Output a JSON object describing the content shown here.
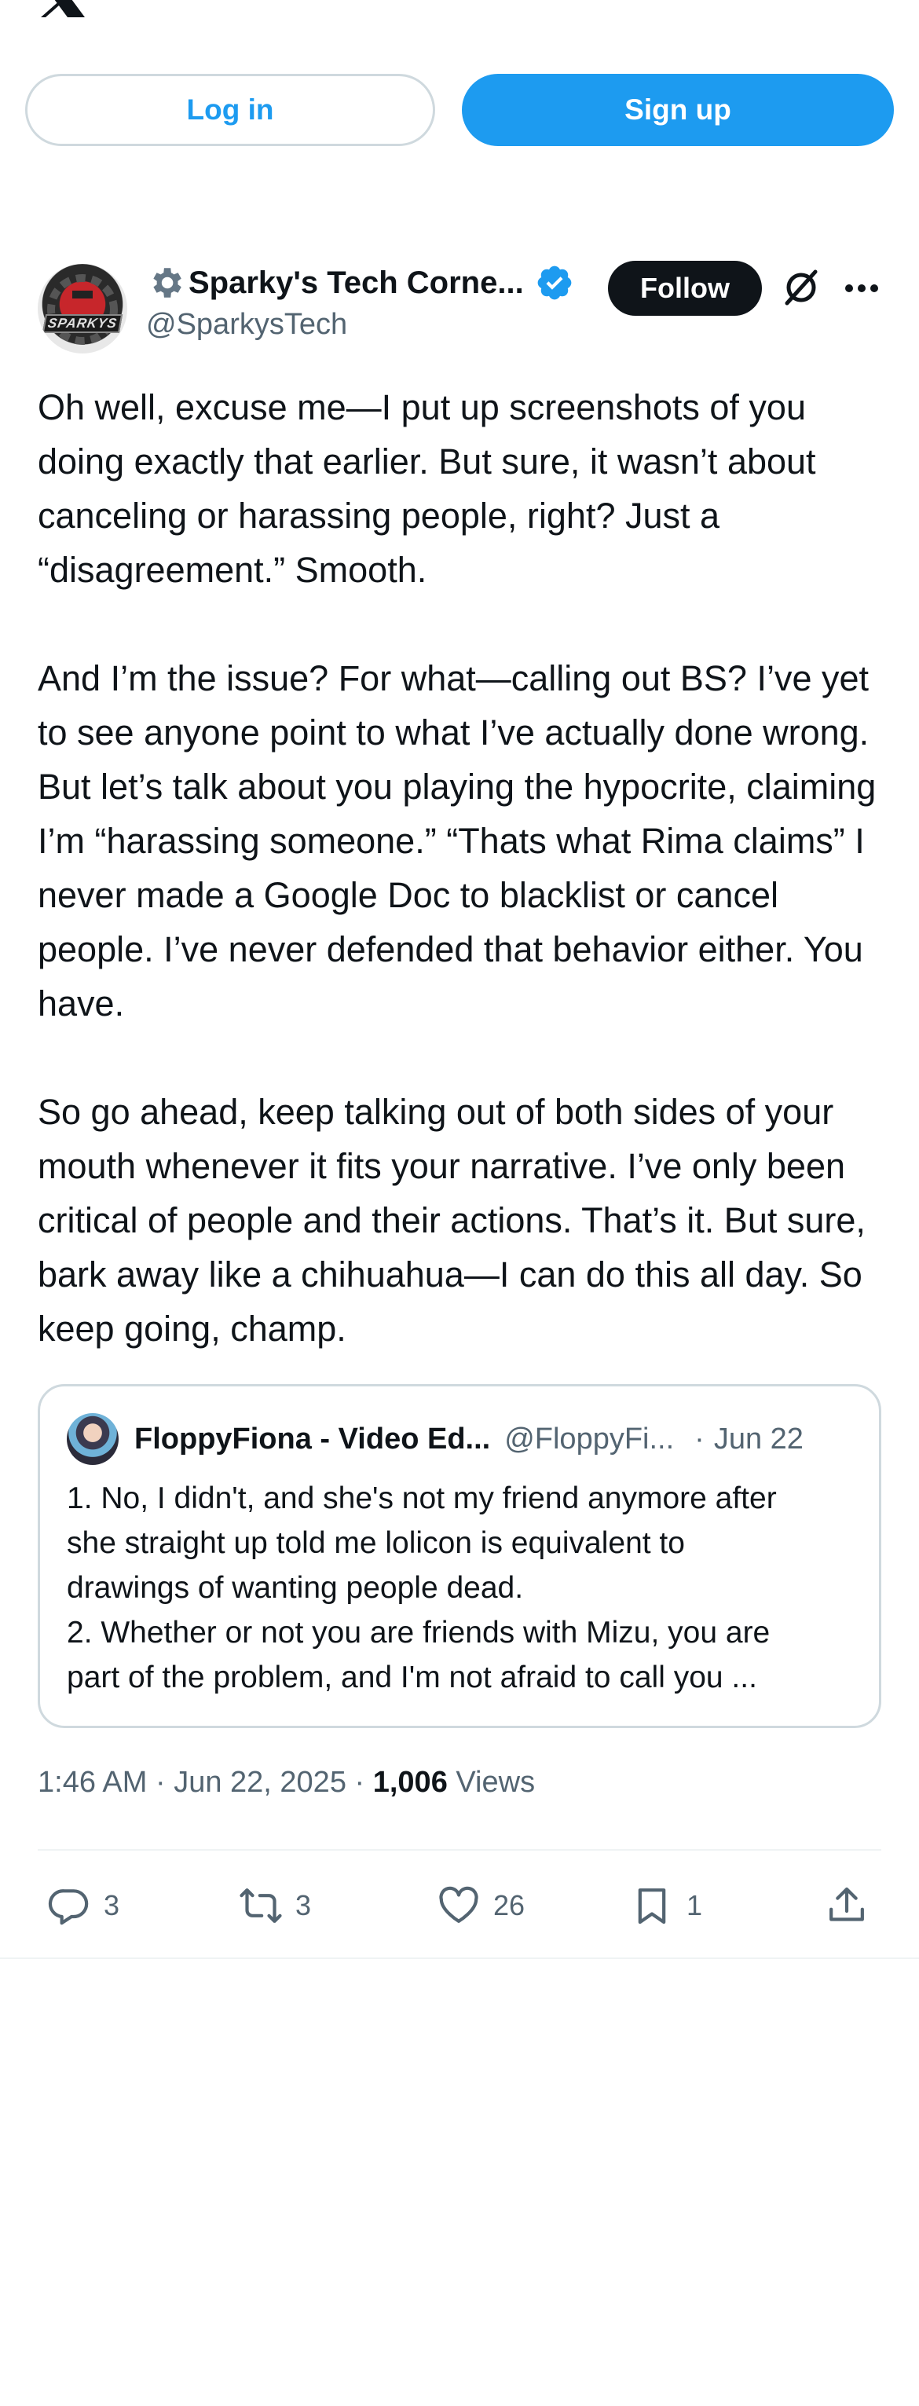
{
  "header": {
    "logo_icon": "x-logo-icon"
  },
  "auth": {
    "login_label": "Log in",
    "signup_label": "Sign up"
  },
  "tweet": {
    "author": {
      "display_name": "Sparky's Tech Corne...",
      "handle": "@SparkysTech",
      "avatar_text": "SPARKYS",
      "verified": true
    },
    "follow_label": "Follow",
    "body": [
      "Oh well, excuse me—I put up screenshots of you doing exactly that earlier. But sure, it wasn’t about canceling or harassing people, right? Just a “disagreement.” Smooth.",
      "And I’m the issue? For what—calling out BS? I’ve yet to see anyone point to what I’ve actually done wrong. But let’s talk about you playing the hypocrite, claiming I’m “harassing someone.” “Thats what Rima claims” I never made a Google Doc to blacklist or cancel people. I’ve never defended that behavior either. You have.",
      "So go ahead, keep talking out of both sides of your mouth whenever it fits your narrative. I’ve only been critical of people and their actions. That’s it. But sure, bark away like a chihuahua—I can do this all day. So keep going, champ."
    ],
    "quote": {
      "display_name": "FloppyFiona - Video Ed...",
      "handle": "@FloppyFi...",
      "separator": "·",
      "date": "Jun 22",
      "lines": [
        "1. No, I didn't, and she's not my friend anymore after",
        "she straight up told me lolicon is equivalent to",
        "drawings of wanting people dead.",
        "2. Whether or not you are friends with Mizu, you are",
        "part of the problem, and I'm not afraid to call you ..."
      ]
    },
    "meta": {
      "time": "1:46 AM",
      "dot1": " · ",
      "date": "Jun 22, 2025",
      "dot2": " · ",
      "views_count": "1,006",
      "views_label": " Views"
    },
    "actions": {
      "replies": "3",
      "reposts": "3",
      "likes": "26",
      "bookmarks": "1"
    }
  },
  "colors": {
    "accent": "#1d9bf0",
    "text": "#0f1419",
    "secondary": "#536471",
    "border": "#cfd9de"
  }
}
